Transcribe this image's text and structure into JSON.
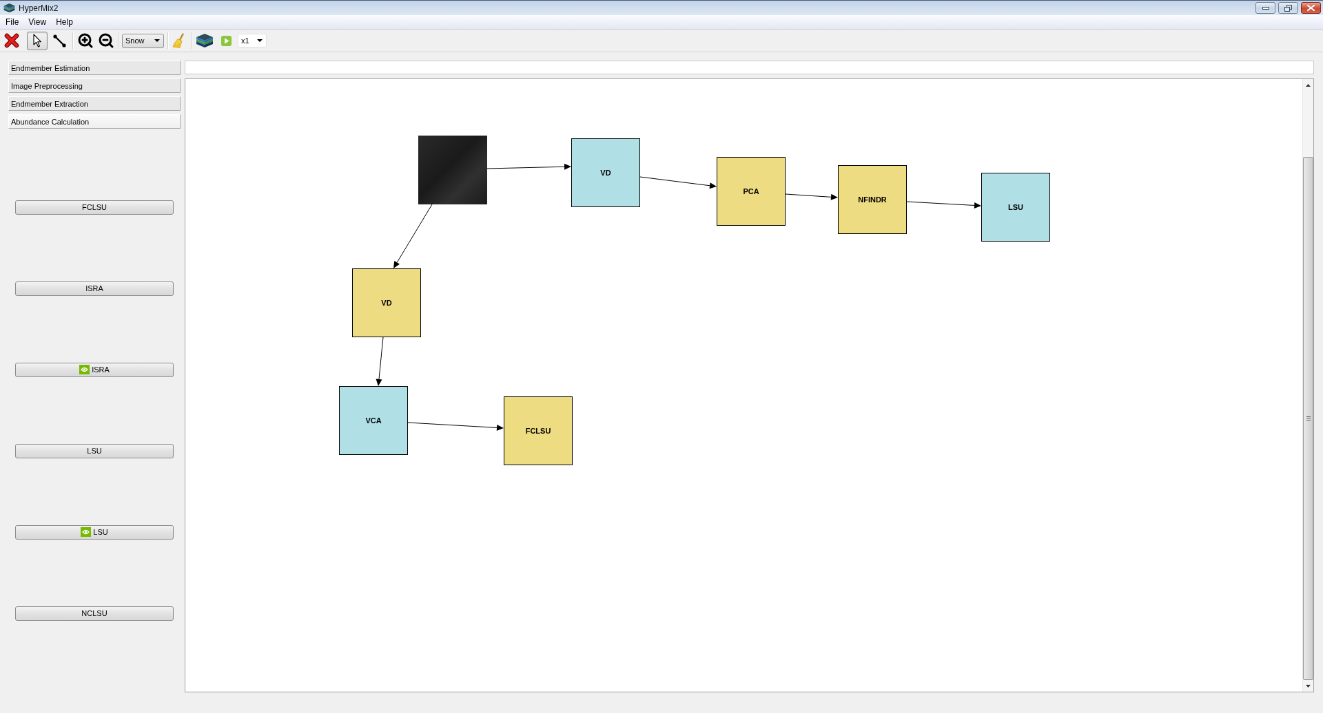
{
  "window": {
    "title": "HyperMix2"
  },
  "menu": [
    "File",
    "View",
    "Help"
  ],
  "toolbar": {
    "mode_tools": [
      {
        "selected": true
      },
      {
        "selected": false
      }
    ],
    "image_dropdown": {
      "value": "Snow"
    },
    "speed_dropdown": {
      "value": "x1"
    }
  },
  "sidebar": {
    "sections": [
      {
        "label": "Endmember Estimation",
        "expanded": false
      },
      {
        "label": "Image Preprocessing",
        "expanded": false
      },
      {
        "label": "Endmember Extraction",
        "expanded": false
      },
      {
        "label": "Abundance Calculation",
        "expanded": true
      }
    ],
    "buttons": [
      {
        "label": "FCLSU",
        "kind": "plain"
      },
      {
        "label": "ISRA",
        "kind": "plain"
      },
      {
        "label": "ISRA",
        "kind": "with-icon"
      },
      {
        "label": "LSU",
        "kind": "plain"
      },
      {
        "label": "LSU",
        "kind": "with-icon"
      },
      {
        "label": "NCLSU",
        "kind": "plain"
      }
    ]
  },
  "canvas": {
    "nodes": [
      {
        "kind": "image"
      },
      {
        "kind": "block",
        "label": "VD",
        "color": "#b0e0e6"
      },
      {
        "kind": "block",
        "label": "PCA",
        "color": "#eedc82"
      },
      {
        "kind": "block",
        "label": "NFINDR",
        "color": "#eedc82"
      },
      {
        "kind": "block",
        "label": "LSU",
        "color": "#b0e0e6"
      },
      {
        "kind": "block",
        "label": "VD",
        "color": "#eedc82"
      },
      {
        "kind": "block",
        "label": "VCA",
        "color": "#b0e0e6"
      },
      {
        "kind": "block",
        "label": "FCLSU",
        "color": "#eedc82"
      }
    ]
  }
}
